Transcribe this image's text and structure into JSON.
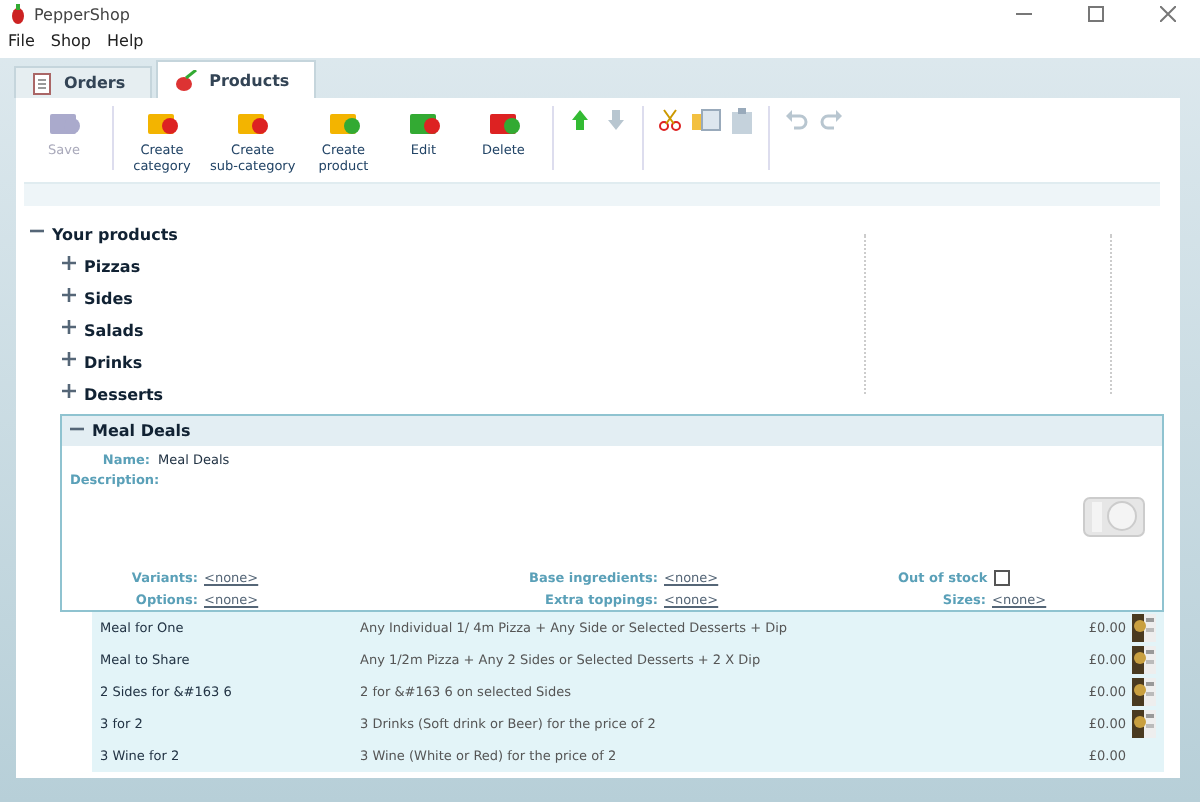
{
  "window": {
    "title": "PepperShop"
  },
  "menu": [
    "File",
    "Shop",
    "Help"
  ],
  "tabs": [
    {
      "label": "Orders",
      "selected": false
    },
    {
      "label": "Products",
      "selected": true
    }
  ],
  "toolbar": [
    {
      "kind": "save",
      "label": "Save",
      "disabled": true
    },
    {
      "kind": "create-category",
      "label": "Create\ncategory",
      "disabled": false
    },
    {
      "kind": "create-subcategory",
      "label": "Create\nsub-category",
      "disabled": false
    },
    {
      "kind": "create-product",
      "label": "Create\nproduct",
      "disabled": false
    },
    {
      "kind": "edit",
      "label": "Edit",
      "disabled": false
    },
    {
      "kind": "delete",
      "label": "Delete",
      "disabled": false
    }
  ],
  "small_tools": [
    {
      "kind": "up",
      "disabled": false
    },
    {
      "kind": "down",
      "disabled": true
    },
    {
      "kind": "sep"
    },
    {
      "kind": "cut",
      "disabled": false
    },
    {
      "kind": "copy",
      "disabled": false
    },
    {
      "kind": "paste",
      "disabled": true
    },
    {
      "kind": "sep"
    },
    {
      "kind": "undo",
      "disabled": true
    },
    {
      "kind": "redo",
      "disabled": true
    }
  ],
  "tree": {
    "label": "Your products",
    "expanded": true,
    "children": [
      {
        "label": "Pizzas",
        "expanded": false
      },
      {
        "label": "Sides",
        "expanded": false
      },
      {
        "label": "Salads",
        "expanded": false
      },
      {
        "label": "Drinks",
        "expanded": false
      },
      {
        "label": "Desserts",
        "expanded": false
      },
      {
        "label": "Meal Deals",
        "expanded": true
      }
    ]
  },
  "detail": {
    "name_label": "Name:",
    "name": "Meal Deals",
    "description_label": "Description:",
    "fields": [
      {
        "label": "Variants:",
        "value": "<none>"
      },
      {
        "label": "Base ingredients:",
        "value": "<none>"
      },
      {
        "label": "Out of stock",
        "kind": "checkbox",
        "checked": false
      },
      {
        "label": "Options:",
        "value": "<none>"
      },
      {
        "label": "Extra toppings:",
        "value": "<none>"
      },
      {
        "label": "Sizes:",
        "value": "<none>"
      }
    ]
  },
  "products": [
    {
      "name": "Meal for One",
      "description": "Any Individual 1/ 4m  Pizza + Any Side or Selected Desserts + Dip",
      "price": "£0.00",
      "thumbnail": true
    },
    {
      "name": "Meal to Share",
      "description": "Any 1/2m  Pizza + Any 2 Sides or Selected Desserts + 2 X Dip",
      "price": "£0.00",
      "thumbnail": true
    },
    {
      "name": "2 Sides for &#163 6",
      "description": "2 for &#163 6 on selected Sides",
      "price": "£0.00",
      "thumbnail": true
    },
    {
      "name": "3 for 2",
      "description": "3 Drinks (Soft drink or Beer) for the price of 2",
      "price": "£0.00",
      "thumbnail": true
    },
    {
      "name": "3 Wine for 2",
      "description": "3 Wine (White or Red) for the price of 2",
      "price": "£0.00",
      "thumbnail": false
    }
  ]
}
